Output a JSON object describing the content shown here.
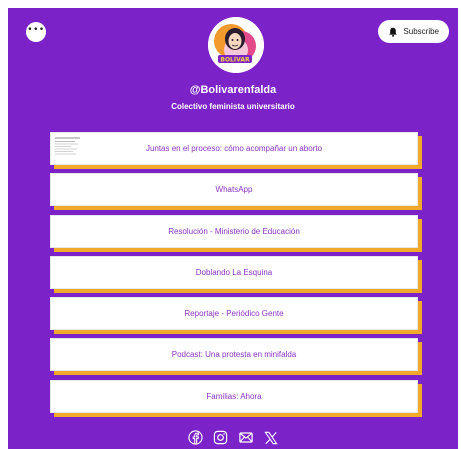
{
  "profile": {
    "handle": "@Bolivarenfalda",
    "bio": "Colectivo feminista universitario",
    "avatar_icon": "bolivar-logo-icon",
    "avatar_text": "BOLÍVAR en falda"
  },
  "header": {
    "more_icon": "more-dots-icon",
    "more_label": "•••",
    "subscribe_label": "Subscribe",
    "subscribe_icon": "bell-icon"
  },
  "links": [
    {
      "label": "Juntas en el proceso: cómo acompañar un aborto",
      "has_thumbnail": true
    },
    {
      "label": "WhatsApp",
      "has_thumbnail": false
    },
    {
      "label": "Resolución - Ministerio de Educación",
      "has_thumbnail": false
    },
    {
      "label": "Doblando La Esquina",
      "has_thumbnail": false
    },
    {
      "label": "Reportaje - Periódico Gente",
      "has_thumbnail": false
    },
    {
      "label": "Podcast: Una protesta en minifalda",
      "has_thumbnail": false
    },
    {
      "label": "Familias: Ahora",
      "has_thumbnail": false
    }
  ],
  "socials": [
    {
      "name": "facebook",
      "icon": "facebook-icon"
    },
    {
      "name": "instagram",
      "icon": "instagram-icon"
    },
    {
      "name": "email",
      "icon": "email-icon"
    },
    {
      "name": "x",
      "icon": "x-icon"
    }
  ],
  "colors": {
    "background": "#7c22c9",
    "card": "#ffffff",
    "card_shadow": "#f0a92a",
    "link_text": "#8a34c4",
    "header_text": "#ffffff"
  }
}
